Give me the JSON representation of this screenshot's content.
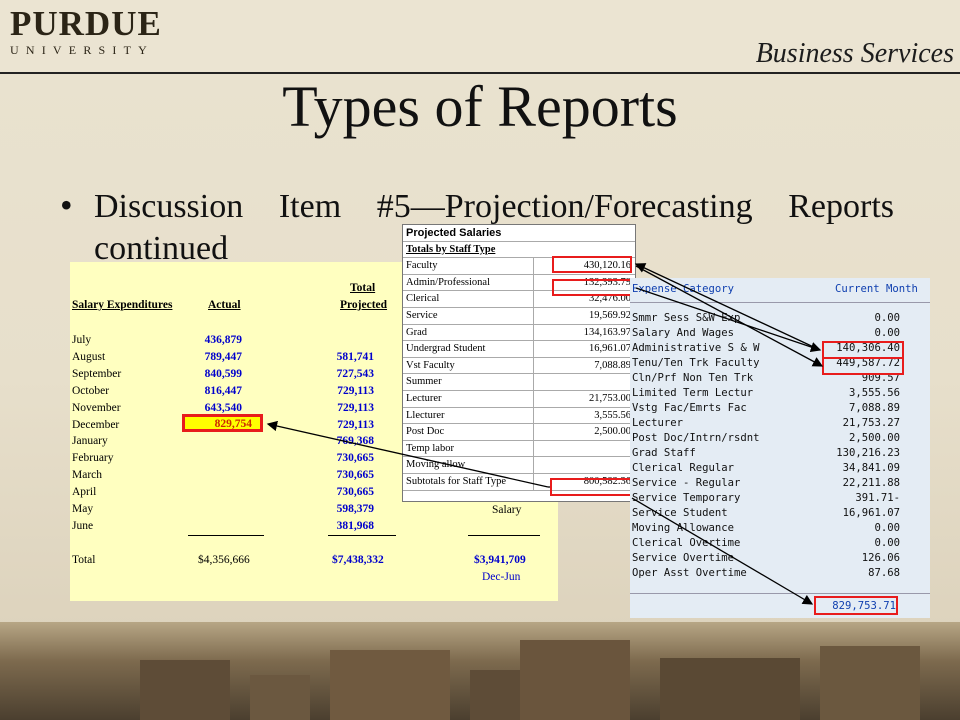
{
  "header": {
    "logo_main": "PURDUE",
    "logo_sub": "UNIVERSITY",
    "department": "Business Services"
  },
  "slide": {
    "title": "Types of Reports",
    "bullet_mark": "•",
    "bullet": "Discussion Item #5—Projection/Forecasting Reports continued"
  },
  "salary_table": {
    "col_label": "Salary Expenditures",
    "col_actual": "Actual",
    "col_total_top": "Total",
    "col_total": "Projected",
    "rows": [
      {
        "month": "July",
        "actual": "436,879",
        "projected": ""
      },
      {
        "month": "August",
        "actual": "789,447",
        "projected": "581,741"
      },
      {
        "month": "September",
        "actual": "840,599",
        "projected": "727,543"
      },
      {
        "month": "October",
        "actual": "816,447",
        "projected": "729,113"
      },
      {
        "month": "November",
        "actual": "643,540",
        "projected": "729,113"
      },
      {
        "month": "December",
        "actual": "829,754",
        "projected": "729,113"
      },
      {
        "month": "January",
        "actual": "",
        "projected": "769,368"
      },
      {
        "month": "February",
        "actual": "",
        "projected": "730,665"
      },
      {
        "month": "March",
        "actual": "",
        "projected": "730,665"
      },
      {
        "month": "April",
        "actual": "",
        "projected": "730,665"
      },
      {
        "month": "May",
        "actual": "",
        "projected": "598,379"
      },
      {
        "month": "June",
        "actual": "",
        "projected": "381,968"
      }
    ],
    "right_label": "Salary",
    "total_label": "Total",
    "total_actual": "$4,356,666",
    "total_projected": "$7,438,332",
    "total_right": "$3,941,709",
    "right_sub": "Dec-Jun"
  },
  "projected_salaries": {
    "title": "Projected Salaries",
    "subtitle": "Totals by Staff Type",
    "rows": [
      {
        "label": "Faculty",
        "value": "430,120.16"
      },
      {
        "label": "Admin/Professional",
        "value": "132,393.79"
      },
      {
        "label": "Clerical",
        "value": "32,476.00"
      },
      {
        "label": "Service",
        "value": "19,569.92"
      },
      {
        "label": "Grad",
        "value": "134,163.97"
      },
      {
        "label": "Undergrad Student",
        "value": "16,961.07"
      },
      {
        "label": "Vst Faculty",
        "value": "7,088.89"
      },
      {
        "label": "Summer",
        "value": ""
      },
      {
        "label": "Lecturer",
        "value": "21,753.00"
      },
      {
        "label": "Llecturer",
        "value": "3,555.56"
      },
      {
        "label": "Post Doc",
        "value": "2,500.00"
      },
      {
        "label": "Temp labor",
        "value": ""
      },
      {
        "label": "Moving allow",
        "value": ""
      },
      {
        "label": "Subtotals for Staff Type",
        "value": "800,582.36"
      }
    ]
  },
  "sap_report": {
    "col_category": "Expense Category",
    "col_month": "Current Month",
    "rows": [
      {
        "label": "Smmr Sess S&W Exp",
        "value": "0.00"
      },
      {
        "label": "Salary And Wages",
        "value": "0.00"
      },
      {
        "label": "Administrative S & W",
        "value": "140,306.40"
      },
      {
        "label": "Tenu/Ten Trk Faculty",
        "value": "449,587.72"
      },
      {
        "label": "Cln/Prf Non Ten Trk",
        "value": "909.57"
      },
      {
        "label": "Limited Term Lectur",
        "value": "3,555.56"
      },
      {
        "label": "Vstg Fac/Emrts Fac",
        "value": "7,088.89"
      },
      {
        "label": "Lecturer",
        "value": "21,753.27"
      },
      {
        "label": "Post Doc/Intrn/rsdnt",
        "value": "2,500.00"
      },
      {
        "label": "Grad Staff",
        "value": "130,216.23"
      },
      {
        "label": "Clerical Regular",
        "value": "34,841.09"
      },
      {
        "label": "Service - Regular",
        "value": "22,211.88"
      },
      {
        "label": "Service Temporary",
        "value": "391.71-"
      },
      {
        "label": "Service Student",
        "value": "16,961.07"
      },
      {
        "label": "Moving Allowance",
        "value": "0.00"
      },
      {
        "label": "Clerical Overtime",
        "value": "0.00"
      },
      {
        "label": "Service Overtime",
        "value": "126.06"
      },
      {
        "label": "Oper Asst Overtime",
        "value": "87.68"
      }
    ],
    "total": "829,753.71"
  },
  "colors": {
    "highlight_border": "#e81c1c",
    "table_blue": "#0000cc",
    "sap_blue": "#1040b0",
    "yellow_bg": "#ffffc0"
  }
}
